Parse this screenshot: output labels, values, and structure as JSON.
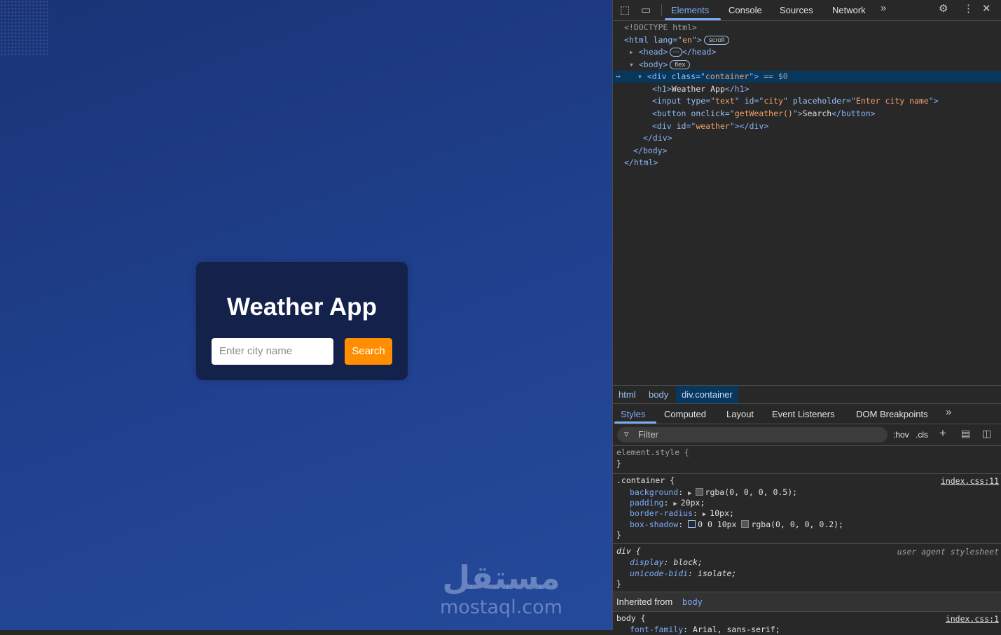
{
  "app": {
    "title": "Weather App",
    "city_placeholder": "Enter city name",
    "search_label": "Search"
  },
  "watermark": {
    "arabic": "مستقل",
    "latin": "mostaql.com"
  },
  "devtools": {
    "tabs": [
      "Elements",
      "Console",
      "Sources",
      "Network"
    ],
    "dom": {
      "doctype": "<!DOCTYPE html>",
      "html_lang": "en",
      "html_badge": "scroll",
      "body_badge": "flex",
      "container_class": "container",
      "selected_ref": "== $0",
      "h1_text": "Weather App",
      "input_type": "text",
      "input_id": "city",
      "input_placeholder": "Enter city name",
      "button_onclick": "getWeather()",
      "button_text": "Search",
      "div_id": "weather"
    },
    "breadcrumbs": [
      "html",
      "body",
      "div.container"
    ],
    "sub_tabs": [
      "Styles",
      "Computed",
      "Layout",
      "Event Listeners",
      "DOM Breakpoints"
    ],
    "filter_placeholder": "Filter",
    "hov": ":hov",
    "cls": ".cls",
    "styles": {
      "element_style": "element.style {",
      "container_selector": ".container {",
      "container_source": "index.css:11",
      "background": "rgba(0, 0, 0, 0.5);",
      "padding": "20px;",
      "border_radius": "10px;",
      "box_shadow_a": "0 0 10px",
      "box_shadow_b": "rgba(0, 0, 0, 0.2);",
      "div_selector": "div {",
      "ua_label": "user agent stylesheet",
      "display": "block;",
      "unicode_bidi": "isolate;",
      "inherited_label": "Inherited from",
      "inherited_from": "body",
      "body_selector": "body {",
      "body_source": "index.css:1",
      "font_family": "Arial, sans-serif;"
    }
  }
}
